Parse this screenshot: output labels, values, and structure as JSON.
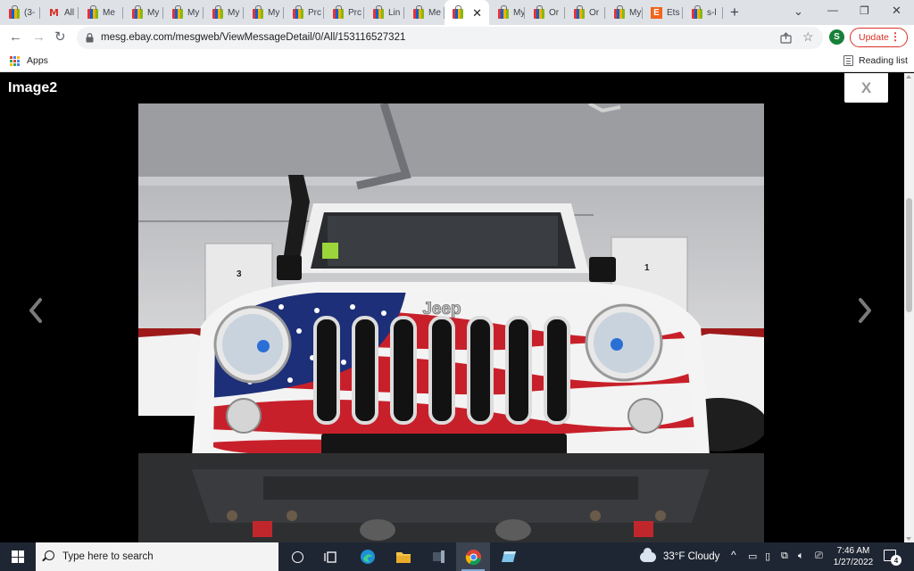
{
  "browser": {
    "tabs": [
      {
        "label": "(3-",
        "icon": "ebay-bag-icon"
      },
      {
        "label": "All",
        "icon": "gmail-icon"
      },
      {
        "label": "Me",
        "icon": "ebay-bag-icon"
      },
      {
        "label": "My",
        "icon": "ebay-bag-icon"
      },
      {
        "label": "My",
        "icon": "ebay-bag-icon"
      },
      {
        "label": "My",
        "icon": "ebay-bag-icon"
      },
      {
        "label": "My",
        "icon": "ebay-bag-icon"
      },
      {
        "label": "Prc",
        "icon": "ebay-bag-icon"
      },
      {
        "label": "Prc",
        "icon": "ebay-bag-icon"
      },
      {
        "label": "Lin",
        "icon": "ebay-bag-icon"
      },
      {
        "label": "Me",
        "icon": "ebay-bag-icon"
      },
      {
        "label": "",
        "icon": "ebay-bag-icon",
        "active": true
      },
      {
        "label": "My",
        "icon": "ebay-bag-icon"
      },
      {
        "label": "Or",
        "icon": "ebay-bag-icon"
      },
      {
        "label": "Or",
        "icon": "ebay-bag-icon"
      },
      {
        "label": "My",
        "icon": "ebay-bag-icon"
      },
      {
        "label": "Ets",
        "icon": "etsy-icon"
      },
      {
        "label": "s-l",
        "icon": "ebay-bag-icon"
      }
    ],
    "active_tab_close": "✕",
    "new_tab": "+",
    "window_controls": {
      "tab_search": "⌄",
      "minimize": "—",
      "restore": "❐",
      "close": "✕"
    },
    "url": "mesg.ebay.com/mesgweb/ViewMessageDetail/0/All/153116527321",
    "profile_initial": "S",
    "update_label": "Update",
    "update_menu": "⋮",
    "bookmarks": {
      "apps_label": "Apps",
      "reading_list_label": "Reading list"
    },
    "colors": {
      "tabstrip": "#dee1e6",
      "update_red": "#d93025",
      "profile_green": "#188038"
    }
  },
  "viewer": {
    "title": "Image2",
    "close_label": "X",
    "prev_icon": "chevron-left-icon",
    "next_icon": "chevron-right-icon",
    "photo": {
      "subject": "white Jeep Wrangler with American flag hood wrap in a garage",
      "grille_badge": "Jeep",
      "parking_numbers": [
        "3",
        "1"
      ]
    }
  },
  "taskbar": {
    "search_placeholder": "Type here to search",
    "weather": "33°F  Cloudy",
    "time": "7:46 AM",
    "date": "1/27/2022",
    "notification_count": "4",
    "tray_chevron": "^",
    "colors": {
      "bg": "#1f2633"
    }
  }
}
